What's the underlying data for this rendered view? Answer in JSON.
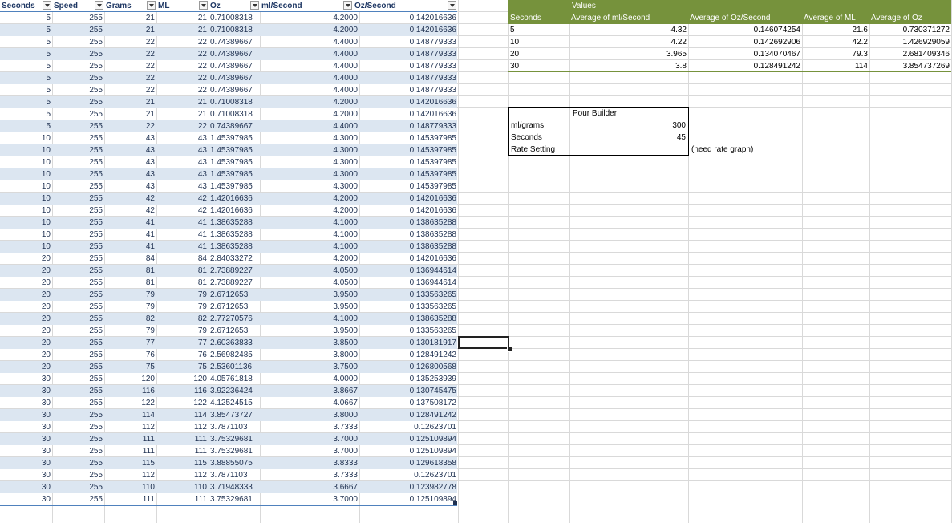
{
  "table": {
    "headers": [
      "Seconds",
      "Speed",
      "Grams",
      "ML",
      "Oz",
      "ml/Second",
      "Oz/Second"
    ],
    "rows": [
      [
        "5",
        "255",
        "21",
        "21",
        "0.71008318",
        "4.2000",
        "0.142016636"
      ],
      [
        "5",
        "255",
        "21",
        "21",
        "0.71008318",
        "4.2000",
        "0.142016636"
      ],
      [
        "5",
        "255",
        "22",
        "22",
        "0.74389667",
        "4.4000",
        "0.148779333"
      ],
      [
        "5",
        "255",
        "22",
        "22",
        "0.74389667",
        "4.4000",
        "0.148779333"
      ],
      [
        "5",
        "255",
        "22",
        "22",
        "0.74389667",
        "4.4000",
        "0.148779333"
      ],
      [
        "5",
        "255",
        "22",
        "22",
        "0.74389667",
        "4.4000",
        "0.148779333"
      ],
      [
        "5",
        "255",
        "22",
        "22",
        "0.74389667",
        "4.4000",
        "0.148779333"
      ],
      [
        "5",
        "255",
        "21",
        "21",
        "0.71008318",
        "4.2000",
        "0.142016636"
      ],
      [
        "5",
        "255",
        "21",
        "21",
        "0.71008318",
        "4.2000",
        "0.142016636"
      ],
      [
        "5",
        "255",
        "22",
        "22",
        "0.74389667",
        "4.4000",
        "0.148779333"
      ],
      [
        "10",
        "255",
        "43",
        "43",
        "1.45397985",
        "4.3000",
        "0.145397985"
      ],
      [
        "10",
        "255",
        "43",
        "43",
        "1.45397985",
        "4.3000",
        "0.145397985"
      ],
      [
        "10",
        "255",
        "43",
        "43",
        "1.45397985",
        "4.3000",
        "0.145397985"
      ],
      [
        "10",
        "255",
        "43",
        "43",
        "1.45397985",
        "4.3000",
        "0.145397985"
      ],
      [
        "10",
        "255",
        "43",
        "43",
        "1.45397985",
        "4.3000",
        "0.145397985"
      ],
      [
        "10",
        "255",
        "42",
        "42",
        "1.42016636",
        "4.2000",
        "0.142016636"
      ],
      [
        "10",
        "255",
        "42",
        "42",
        "1.42016636",
        "4.2000",
        "0.142016636"
      ],
      [
        "10",
        "255",
        "41",
        "41",
        "1.38635288",
        "4.1000",
        "0.138635288"
      ],
      [
        "10",
        "255",
        "41",
        "41",
        "1.38635288",
        "4.1000",
        "0.138635288"
      ],
      [
        "10",
        "255",
        "41",
        "41",
        "1.38635288",
        "4.1000",
        "0.138635288"
      ],
      [
        "20",
        "255",
        "84",
        "84",
        "2.84033272",
        "4.2000",
        "0.142016636"
      ],
      [
        "20",
        "255",
        "81",
        "81",
        "2.73889227",
        "4.0500",
        "0.136944614"
      ],
      [
        "20",
        "255",
        "81",
        "81",
        "2.73889227",
        "4.0500",
        "0.136944614"
      ],
      [
        "20",
        "255",
        "79",
        "79",
        "2.6712653",
        "3.9500",
        "0.133563265"
      ],
      [
        "20",
        "255",
        "79",
        "79",
        "2.6712653",
        "3.9500",
        "0.133563265"
      ],
      [
        "20",
        "255",
        "82",
        "82",
        "2.77270576",
        "4.1000",
        "0.138635288"
      ],
      [
        "20",
        "255",
        "79",
        "79",
        "2.6712653",
        "3.9500",
        "0.133563265"
      ],
      [
        "20",
        "255",
        "77",
        "77",
        "2.60363833",
        "3.8500",
        "0.130181917"
      ],
      [
        "20",
        "255",
        "76",
        "76",
        "2.56982485",
        "3.8000",
        "0.128491242"
      ],
      [
        "20",
        "255",
        "75",
        "75",
        "2.53601136",
        "3.7500",
        "0.126800568"
      ],
      [
        "30",
        "255",
        "120",
        "120",
        "4.05761818",
        "4.0000",
        "0.135253939"
      ],
      [
        "30",
        "255",
        "116",
        "116",
        "3.92236424",
        "3.8667",
        "0.130745475"
      ],
      [
        "30",
        "255",
        "122",
        "122",
        "4.12524515",
        "4.0667",
        "0.137508172"
      ],
      [
        "30",
        "255",
        "114",
        "114",
        "3.85473727",
        "3.8000",
        "0.128491242"
      ],
      [
        "30",
        "255",
        "112",
        "112",
        "3.7871103",
        "3.7333",
        "0.12623701"
      ],
      [
        "30",
        "255",
        "111",
        "111",
        "3.75329681",
        "3.7000",
        "0.125109894"
      ],
      [
        "30",
        "255",
        "111",
        "111",
        "3.75329681",
        "3.7000",
        "0.125109894"
      ],
      [
        "30",
        "255",
        "115",
        "115",
        "3.88855075",
        "3.8333",
        "0.129618358"
      ],
      [
        "30",
        "255",
        "112",
        "112",
        "3.7871103",
        "3.7333",
        "0.12623701"
      ],
      [
        "30",
        "255",
        "110",
        "110",
        "3.71948333",
        "3.6667",
        "0.123982778"
      ],
      [
        "30",
        "255",
        "111",
        "111",
        "3.75329681",
        "3.7000",
        "0.125109894"
      ]
    ]
  },
  "pivot": {
    "values_label": "Values",
    "headers": [
      "Seconds",
      "Average of ml/Second",
      "Average of Oz/Second",
      "Average of ML",
      "Average of Oz"
    ],
    "rows": [
      [
        "5",
        "4.32",
        "0.146074254",
        "21.6",
        "0.730371272"
      ],
      [
        "10",
        "4.22",
        "0.142692906",
        "42.2",
        "1.426929059"
      ],
      [
        "20",
        "3.965",
        "0.134070467",
        "79.3",
        "2.681409346"
      ],
      [
        "30",
        "3.8",
        "0.128491242",
        "114",
        "3.854737269"
      ]
    ]
  },
  "pour_builder": {
    "title": "Pour Builder",
    "rows": [
      {
        "label": "ml/grams",
        "value": "300"
      },
      {
        "label": "Seconds",
        "value": "45"
      },
      {
        "label": "Rate Setting",
        "value": ""
      }
    ],
    "note": "(need rate graph)"
  },
  "colors": {
    "table_header_border": "#4f81bd",
    "band_fill": "#dce6f1",
    "pivot_header": "#76923c",
    "text": "#1e3050",
    "gridline": "#d9d9d9"
  }
}
